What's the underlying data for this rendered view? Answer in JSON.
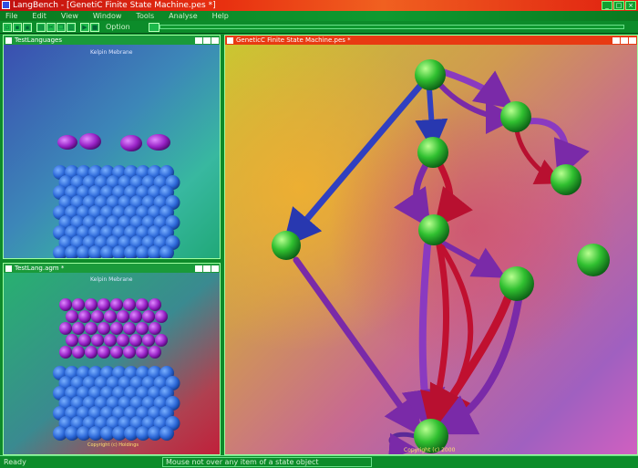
{
  "app": {
    "title": "LangBench - [GenetiC Finite State Machine.pes *]",
    "colors": {
      "chrome_green": "#0d8a2a",
      "title_red": "#d82010",
      "active_window_title": "#e83a12"
    }
  },
  "menu": {
    "items": [
      "File",
      "Edit",
      "View",
      "Window",
      "Tools",
      "Analyse",
      "Help"
    ]
  },
  "toolbar": {
    "icons": [
      "new-icon",
      "open-icon",
      "save-icon",
      "print-icon",
      "cut-icon",
      "copy-icon",
      "paste-icon",
      "run-icon",
      "stop-icon"
    ],
    "options_label": "Option"
  },
  "windows": {
    "test1": {
      "title": "TestLanguages",
      "caption": "Kelpin Mebrane"
    },
    "test2": {
      "title": "TestLang.agm *",
      "caption": "Kelpin Mebrane",
      "copyright": "Copyright (c) Holdings"
    },
    "fsm": {
      "title": "GeneticC Finite State Machine.pes *",
      "copyright": "Copyright (c) 2000"
    }
  },
  "status": {
    "ready": "Ready",
    "message": "Mouse not over any item of a state object"
  }
}
